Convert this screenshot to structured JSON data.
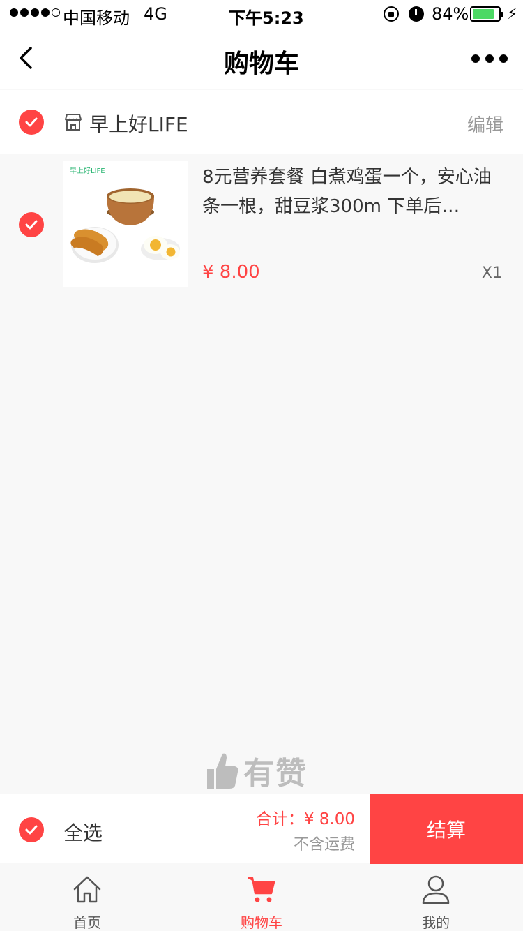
{
  "status_bar": {
    "carrier": "中国移动",
    "network": "4G",
    "time": "下午5:23",
    "battery_percent": "84%",
    "battery_level": 0.84
  },
  "nav": {
    "title": "购物车",
    "back_icon": "chevron-left-icon",
    "more_icon": "more-dots-icon"
  },
  "shop": {
    "name": "早上好LIFE",
    "edit_label": "编辑",
    "checked": true
  },
  "cart_items": [
    {
      "title": "8元营养套餐 白煮鸡蛋一个，安心油条一根，甜豆浆300m 下单后…",
      "image_caption": "早上好LIFE",
      "price": "¥ 8.00",
      "quantity": "X1",
      "checked": true
    }
  ],
  "watermark": {
    "text": "有赞"
  },
  "checkout": {
    "select_all_label": "全选",
    "total": "合计：¥ 8.00",
    "shipping_note": "不含运费",
    "button_label": "结算"
  },
  "tabs": [
    {
      "label": "首页",
      "icon": "home-icon",
      "active": false
    },
    {
      "label": "购物车",
      "icon": "cart-icon",
      "active": true
    },
    {
      "label": "我的",
      "icon": "user-icon",
      "active": false
    }
  ],
  "colors": {
    "accent": "#ff4444",
    "background": "#f8f8f8",
    "battery": "#4cd964"
  }
}
